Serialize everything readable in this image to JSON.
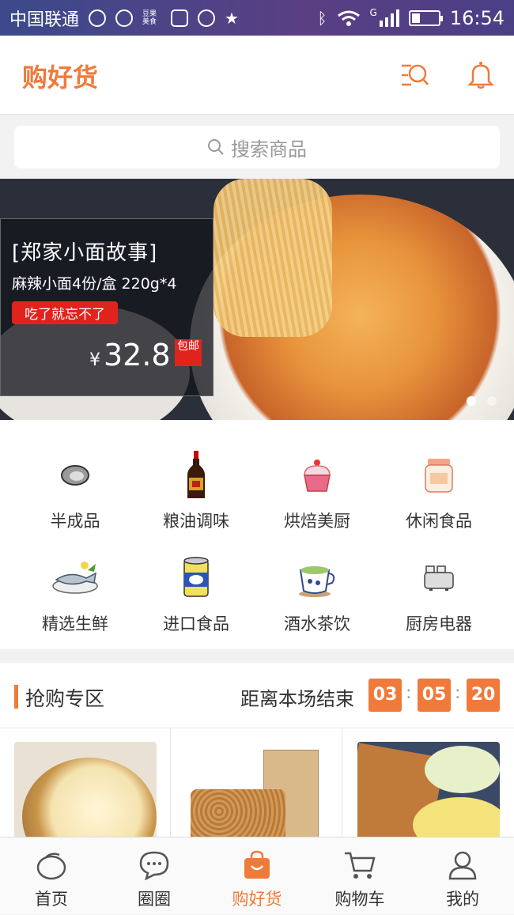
{
  "status_bar": {
    "carrier": "中国联通",
    "network": "G",
    "time": "16:54",
    "app_badge": "豆果美食"
  },
  "header": {
    "title": "购好货"
  },
  "search": {
    "placeholder": "搜索商品"
  },
  "banner": {
    "headline": "[郑家小面故事]",
    "subtitle": "麻辣小面4份/盒 220g*4",
    "tag": "吃了就忘不了",
    "currency": "¥",
    "price": "32.8",
    "free_shipping": "包邮",
    "slide_count": 2,
    "active_slide": 1
  },
  "categories": [
    {
      "label": "半成品",
      "icon": "oyster-icon"
    },
    {
      "label": "粮油调味",
      "icon": "soy-sauce-bottle-icon"
    },
    {
      "label": "烘焙美厨",
      "icon": "cupcake-icon"
    },
    {
      "label": "休闲食品",
      "icon": "snack-jar-icon"
    },
    {
      "label": "精选生鲜",
      "icon": "fish-icon"
    },
    {
      "label": "进口食品",
      "icon": "canned-food-icon"
    },
    {
      "label": "酒水茶饮",
      "icon": "tea-cup-icon"
    },
    {
      "label": "厨房电器",
      "icon": "toaster-icon"
    }
  ],
  "flash_sale": {
    "title": "抢购专区",
    "countdown_label": "距离本场结束",
    "hours": "03",
    "minutes": "05",
    "seconds": "20",
    "separator": ":"
  },
  "tabbar": [
    {
      "label": "首页",
      "icon": "home-icon",
      "active": false
    },
    {
      "label": "圈圈",
      "icon": "chat-bubble-icon",
      "active": false
    },
    {
      "label": "购好货",
      "icon": "shopping-bag-icon",
      "active": true
    },
    {
      "label": "购物车",
      "icon": "cart-icon",
      "active": false
    },
    {
      "label": "我的",
      "icon": "user-icon",
      "active": false
    }
  ],
  "colors": {
    "accent": "#f07a3a",
    "sale_red": "#e0231d"
  }
}
